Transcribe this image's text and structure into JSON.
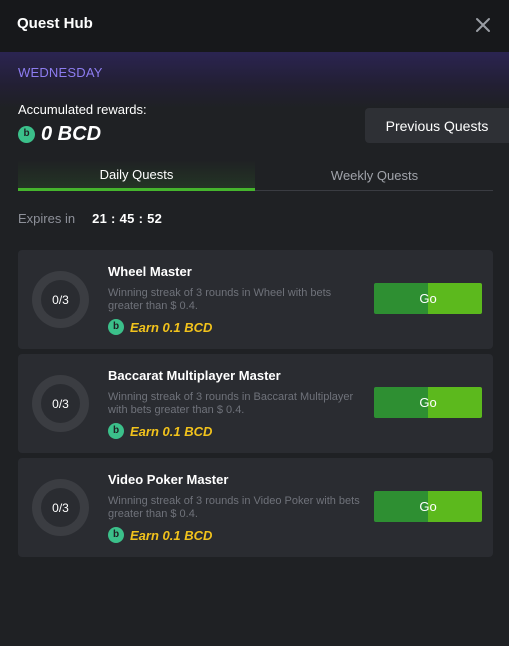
{
  "header": {
    "title": "Quest Hub",
    "close_icon": "close-icon"
  },
  "banner": {
    "day": "WEDNESDAY"
  },
  "rewards": {
    "label": "Accumulated rewards:",
    "amount": "0 BCD",
    "coin_icon": "bcd-coin-icon"
  },
  "previous_button": "Previous Quests",
  "tabs": [
    {
      "label": "Daily Quests",
      "active": true
    },
    {
      "label": "Weekly Quests",
      "active": false
    }
  ],
  "expires": {
    "label": "Expires in",
    "time": "21 : 45 : 52"
  },
  "quests": [
    {
      "progress": "0/3",
      "name": "Wheel Master",
      "description": "Winning streak of 3 rounds in Wheel with bets greater than $ 0.4.",
      "reward": "Earn 0.1 BCD",
      "button": "Go"
    },
    {
      "progress": "0/3",
      "name": "Baccarat Multiplayer Master",
      "description": "Winning streak of 3 rounds in Baccarat Multiplayer with bets greater than $ 0.4.",
      "reward": "Earn 0.1 BCD",
      "button": "Go"
    },
    {
      "progress": "0/3",
      "name": "Video Poker Master",
      "description": "Winning streak of 3 rounds in Video Poker with bets greater than $ 0.4.",
      "reward": "Earn 0.1 BCD",
      "button": "Go"
    }
  ],
  "colors": {
    "accent_green": "#45b52d",
    "reward_gold": "#f2c31c",
    "day_purple": "#8d7cf0",
    "coin_green": "#3bc08a"
  }
}
